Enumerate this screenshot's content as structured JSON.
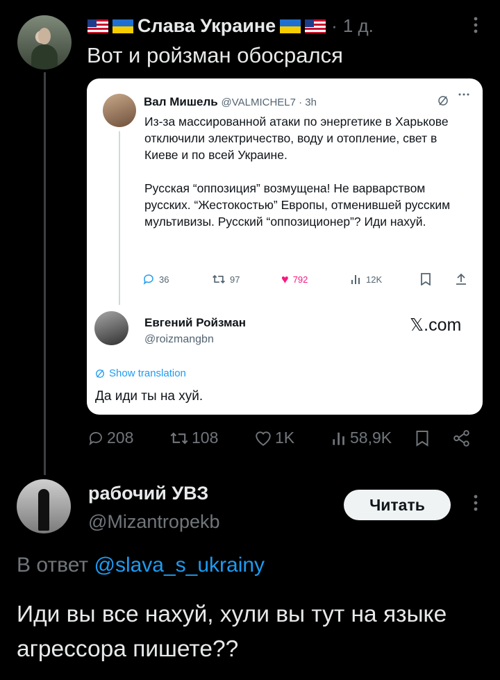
{
  "tweet1": {
    "author_name": "Слава Украине",
    "time": "1 д.",
    "text": "Вот и ройзман обосрался",
    "quote": {
      "author_name": "Вал Мишель",
      "handle_time": "@VALMICHEL7 · 3h",
      "paragraph1": "Из-за массированной атаки по энергетике в Харькове отключили электричество, воду и отопление, свет в Киеве и по всей Украине.",
      "paragraph2": "Русская “оппозиция” возмущена! Не варварством русских. “Жестокостью” Европы, отменившей русским мультивизы. Русский “оппозиционер”? Иди нахуй.",
      "stats": {
        "replies": "36",
        "reposts": "97",
        "likes": "792",
        "views": "12K"
      },
      "reply_author_name": "Евгений Ройзман",
      "reply_handle": "@roizmangbn",
      "source": "𝕏.com",
      "translate_label": "Show translation",
      "reply_text": "Да иди ты на хуй."
    },
    "actions": {
      "replies": "208",
      "reposts": "108",
      "likes": "1K",
      "views": "58,9K"
    }
  },
  "tweet2": {
    "author_name": "рабочий УВЗ",
    "handle": "@Mizantropekb",
    "follow_label": "Читать",
    "reply_prefix": "В ответ",
    "reply_mention": "@slava_s_ukrainy",
    "text": "Иди вы все нахуй, хули вы тут на языке агрессора пишете??"
  },
  "colors": {
    "background": "#000000",
    "text": "#e7e9ea",
    "muted": "#71767b",
    "link": "#1d9bf0",
    "like": "#f91880"
  },
  "icons": [
    "flag-us-icon",
    "flag-ua-icon",
    "more-icon",
    "reply-icon",
    "repost-icon",
    "like-icon",
    "views-icon",
    "bookmark-icon",
    "share-icon",
    "grok-icon"
  ]
}
